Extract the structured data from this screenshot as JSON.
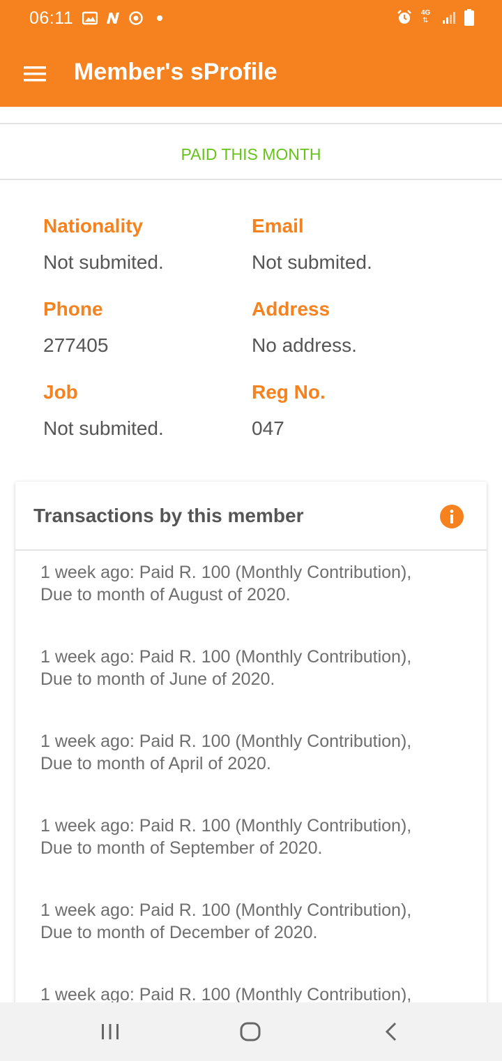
{
  "status_bar": {
    "time": "06:11",
    "left_icons": [
      "gallery-icon",
      "n-app-icon",
      "sync-icon",
      "dot-icon"
    ],
    "right_icons": [
      "alarm-icon",
      "4g-data-icon",
      "signal-icon",
      "battery-icon"
    ],
    "network_label": "4G"
  },
  "toolbar": {
    "title": "Member's sProfile",
    "menu_icon": "hamburger-menu-icon"
  },
  "payment_status": "PAID THIS MONTH",
  "fields": {
    "nationality": {
      "label": "Nationality",
      "value": "Not submited."
    },
    "email": {
      "label": "Email",
      "value": "Not submited."
    },
    "phone": {
      "label": "Phone",
      "value": "277405"
    },
    "address": {
      "label": "Address",
      "value": "No address."
    },
    "job": {
      "label": "Job",
      "value": "Not submited."
    },
    "reg_no": {
      "label": "Reg No.",
      "value": "047"
    }
  },
  "transactions": {
    "title": "Transactions by this member",
    "info_icon": "info-icon",
    "items": [
      {
        "line1": "1 week ago: Paid R. 100 (Monthly Contribution),",
        "line2": "Due to month of August of 2020."
      },
      {
        "line1": "1 week ago: Paid R. 100 (Monthly Contribution),",
        "line2": "Due to month of June of 2020."
      },
      {
        "line1": "1 week ago: Paid R. 100 (Monthly Contribution),",
        "line2": "Due to month of April of 2020."
      },
      {
        "line1": "1 week ago: Paid R. 100 (Monthly Contribution),",
        "line2": "Due to month of September of 2020."
      },
      {
        "line1": "1 week ago: Paid R. 100 (Monthly Contribution),",
        "line2": "Due to month of December of 2020."
      },
      {
        "line1": "1 week ago: Paid R. 100 (Monthly Contribution),",
        "line2": ""
      }
    ]
  },
  "colors": {
    "accent": "#f5821f",
    "paid_green": "#67c21a",
    "text_gray": "#555555"
  },
  "nav_bar": {
    "icons": [
      "recent-apps-icon",
      "home-icon",
      "back-icon"
    ]
  }
}
